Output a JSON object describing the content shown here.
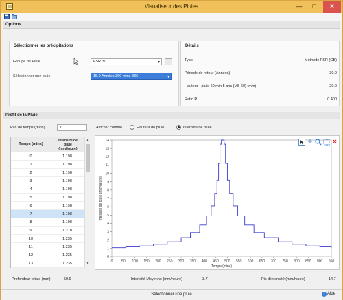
{
  "window": {
    "title": "Visualiseur des Pluies",
    "accent": "#f0c05a",
    "close_color": "#d9534f"
  },
  "options": {
    "header": "Options",
    "select_group": {
      "title": "Sélectionner les précipitations",
      "group_label": "Groupe de Pluie",
      "group_value": "FSR 30",
      "rain_label": "Sélectionner une pluie",
      "rain_value": "15.0 Années 360 mins 336"
    },
    "details": {
      "title": "Détails",
      "rows": [
        {
          "k": "Type",
          "v": "Méthode FSR (GB)"
        },
        {
          "k": "Période de retour (Années)",
          "v": "30.0"
        },
        {
          "k": "Hauteur - pluie 60 min 5 ans (M5-60) (mm)",
          "v": "20.0"
        },
        {
          "k": "Ratio R",
          "v": "0.400"
        }
      ]
    }
  },
  "profile": {
    "header": "Profil de la Pluie",
    "timestep_label": "Pas de temps (mins)",
    "timestep_value": "1",
    "display_label": "Afficher comme",
    "radio_depth": "Hauteur de pluie",
    "radio_intensity": "Intensité de pluie",
    "table": {
      "col_time": "Temps (mins)",
      "col_intensity_1": "Intensité de",
      "col_intensity_2": "pluie",
      "col_intensity_3": "(mm/heure)",
      "rows": [
        {
          "t": "0",
          "v": "1.198"
        },
        {
          "t": "1",
          "v": "1.198"
        },
        {
          "t": "2",
          "v": "1.198"
        },
        {
          "t": "3",
          "v": "1.198"
        },
        {
          "t": "4",
          "v": "1.198"
        },
        {
          "t": "5",
          "v": "1.198"
        },
        {
          "t": "6",
          "v": "1.198"
        },
        {
          "t": "7",
          "v": "1.198"
        },
        {
          "t": "8",
          "v": "1.198"
        },
        {
          "t": "9",
          "v": "1.210"
        },
        {
          "t": "10",
          "v": "1.235"
        },
        {
          "t": "11",
          "v": "1.235"
        },
        {
          "t": "12",
          "v": "1.235"
        },
        {
          "t": "13",
          "v": "1.235"
        }
      ],
      "selected_index": 7
    }
  },
  "chart_data": {
    "type": "line",
    "xlabel": "Temps (mins)",
    "ylabel": "Intensité de pluie (mm/heure)",
    "xlim": [
      0,
      950
    ],
    "ylim": [
      0,
      14
    ],
    "xticks": [
      "0",
      "50",
      "100",
      "150",
      "200",
      "250",
      "300",
      "350",
      "400",
      "450",
      "500",
      "550",
      "600",
      "650",
      "700",
      "750",
      "800",
      "850",
      "900",
      "950"
    ],
    "yticks": [
      "0",
      "1",
      "2",
      "3",
      "4",
      "5",
      "6",
      "7",
      "8",
      "9",
      "10",
      "11",
      "12",
      "13",
      "14"
    ],
    "series": [
      {
        "color": "#3a3ad0",
        "x": [
          0,
          60,
          120,
          180,
          240,
          300,
          340,
          380,
          410,
          430,
          445,
          455,
          462,
          468,
          474,
          480,
          486,
          492,
          500,
          510,
          525,
          545,
          575,
          615,
          660,
          720,
          780,
          840,
          900,
          950
        ],
        "y": [
          1.1,
          1.2,
          1.3,
          1.5,
          1.8,
          2.3,
          2.9,
          3.8,
          4.9,
          6.1,
          7.6,
          9.2,
          11.2,
          13.5,
          14.0,
          14.0,
          13.5,
          11.2,
          9.2,
          7.6,
          6.1,
          4.9,
          3.8,
          2.9,
          2.3,
          1.8,
          1.5,
          1.3,
          1.2,
          1.1
        ]
      }
    ],
    "grid": false
  },
  "stats": {
    "total_depth_label": "Profondeur totale (mm)",
    "total_depth_value": "59.9",
    "mean_intensity_label": "Intensité Moyenne (mm/heure)",
    "mean_intensity_value": "3.7",
    "peak_intensity_label": "Pic d'intensité (mm/heure)",
    "peak_intensity_value": "14.7"
  },
  "status": {
    "text": "Sélectionner une pluie",
    "help": "Aide"
  }
}
